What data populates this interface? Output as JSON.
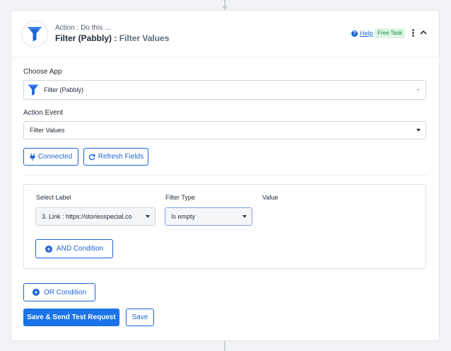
{
  "header": {
    "subtitle": "Action : Do this ...",
    "app_name": "Filter (Pabbly)",
    "separator": ":",
    "event_name": "Filter Values",
    "help_label": "Help",
    "badge": "Free Task"
  },
  "form": {
    "choose_app_label": "Choose App",
    "choose_app_value": "Filter (Pabbly)",
    "action_event_label": "Action Event",
    "action_event_value": "Filter Values",
    "connected_label": "Connected",
    "refresh_label": "Refresh Fields"
  },
  "filter": {
    "select_label_header": "Select Label",
    "filter_type_header": "Filter Type",
    "value_header": "Value",
    "select_label_value": "3. Link : https://storiesspecial.co",
    "filter_type_value": "Is empty",
    "and_condition_label": "AND Condition"
  },
  "actions": {
    "or_condition_label": "OR Condition",
    "save_send_label": "Save & Send Test Request",
    "save_label": "Save"
  },
  "colors": {
    "accent": "#1a73e8",
    "badge_bg": "#dcf5e4",
    "badge_text": "#1d8a48"
  }
}
